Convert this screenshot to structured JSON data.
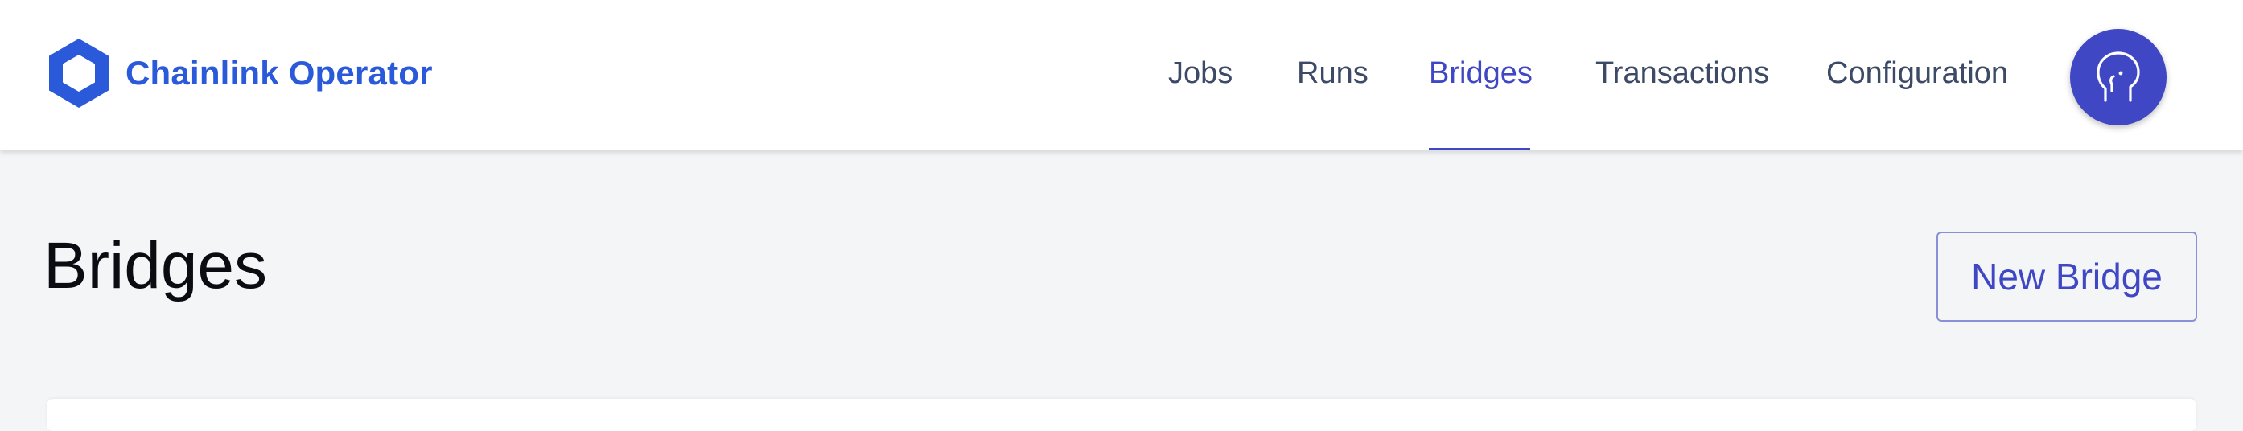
{
  "brand": {
    "name": "Chainlink Operator",
    "logo_icon": "chainlink-hexagon-icon",
    "color": "#2a5ada"
  },
  "nav": {
    "items": [
      {
        "label": "Jobs",
        "active": false
      },
      {
        "label": "Runs",
        "active": false
      },
      {
        "label": "Bridges",
        "active": true
      },
      {
        "label": "Transactions",
        "active": false
      },
      {
        "label": "Configuration",
        "active": false
      }
    ],
    "active_color": "#3f47c4"
  },
  "avatar": {
    "icon": "head-profile-icon",
    "color": "#3f47c4"
  },
  "page": {
    "title": "Bridges"
  },
  "actions": {
    "new_bridge_label": "New Bridge"
  }
}
